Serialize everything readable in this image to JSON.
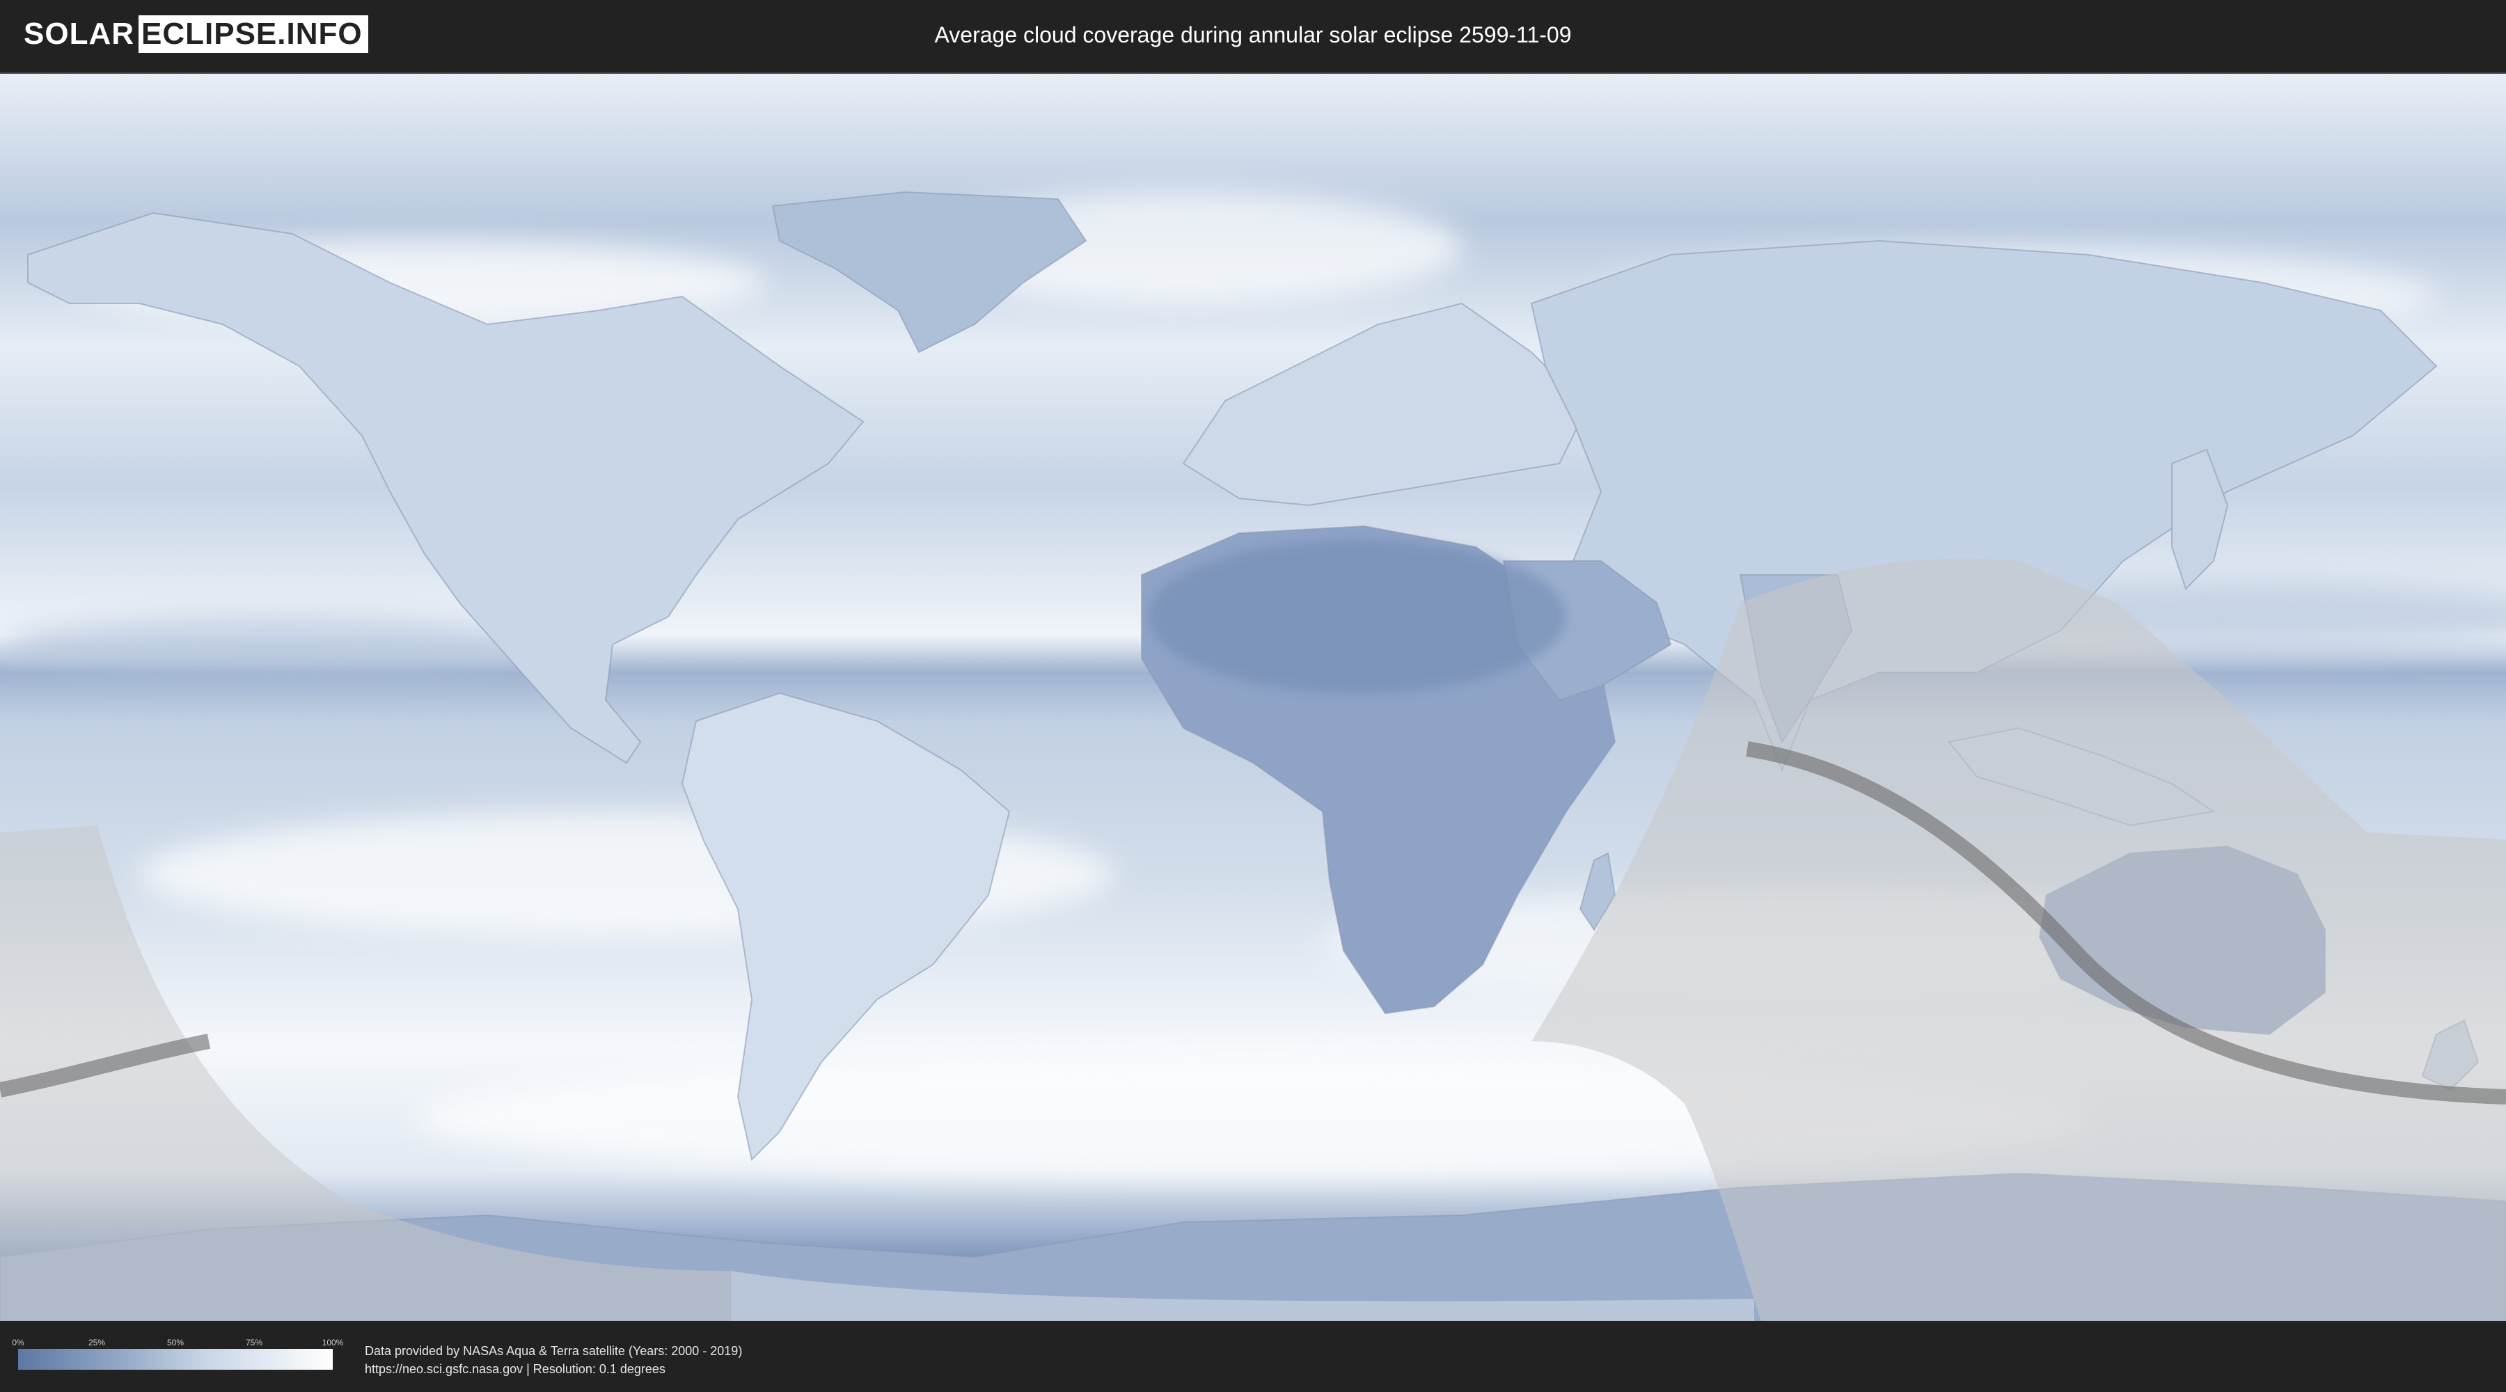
{
  "header": {
    "logo_left": "SOLAR",
    "logo_right": "ECLIPSE.INFO",
    "title": "Average cloud coverage during annular solar eclipse 2599-11-09"
  },
  "map": {
    "type": "equirectangular world map",
    "layer": "average cloud coverage",
    "colors": {
      "clear": "#5d78a4",
      "cloudy": "#ffffff",
      "eclipse_overlay": "#c8c8c8",
      "central_path": "#6a6a6a"
    },
    "features": [
      "continents",
      "country borders",
      "penumbral shadow region",
      "annular central path"
    ]
  },
  "legend": {
    "ticks": [
      "0%",
      "25%",
      "50%",
      "75%",
      "100%"
    ],
    "gradient_colors": [
      "#5d78a4",
      "#8ea4c4",
      "#c9d6e6",
      "#ffffff"
    ]
  },
  "footer": {
    "credit_line1": "Data provided by NASAs Aqua & Terra satellite (Years: 2000 - 2019)",
    "credit_line2": "https://neo.sci.gsfc.nasa.gov | Resolution: 0.1 degrees"
  }
}
